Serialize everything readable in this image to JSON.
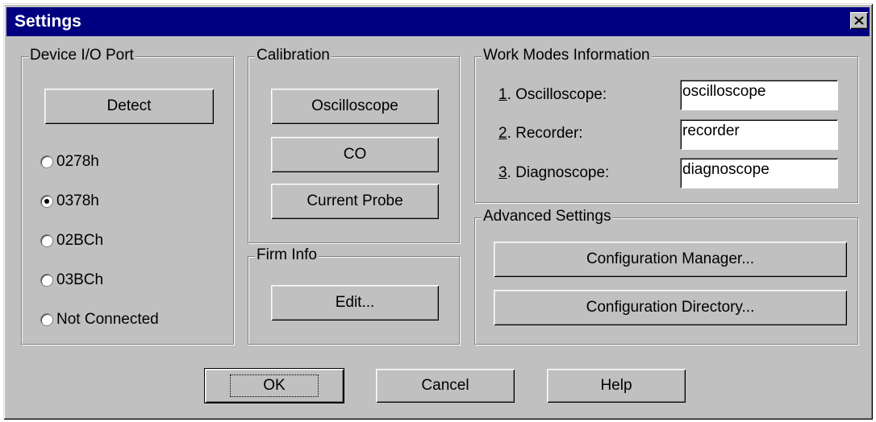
{
  "window": {
    "title": "Settings"
  },
  "device_io": {
    "legend": "Device I/O Port",
    "detect_label": "Detect",
    "ports": [
      {
        "label": "0278h",
        "selected": false
      },
      {
        "label": "0378h",
        "selected": true
      },
      {
        "label": "02BCh",
        "selected": false
      },
      {
        "label": "03BCh",
        "selected": false
      },
      {
        "label": "Not Connected",
        "selected": false
      }
    ]
  },
  "calibration": {
    "legend": "Calibration",
    "oscilloscope_label": "Oscilloscope",
    "co_label": "CO",
    "current_probe_label": "Current Probe"
  },
  "firm_info": {
    "legend": "Firm Info",
    "edit_label": "Edit..."
  },
  "work_modes": {
    "legend": "Work Modes Information",
    "modes": [
      {
        "number": "1",
        "label": ". Oscilloscope:",
        "value": "oscilloscope"
      },
      {
        "number": "2",
        "label": ". Recorder:",
        "value": "recorder"
      },
      {
        "number": "3",
        "label": ". Diagnoscope:",
        "value": "diagnoscope"
      }
    ]
  },
  "advanced": {
    "legend": "Advanced Settings",
    "config_manager_label": "Configuration Manager...",
    "config_directory_label": "Configuration Directory..."
  },
  "footer": {
    "ok_label": "OK",
    "cancel_label": "Cancel",
    "help_label": "Help"
  }
}
